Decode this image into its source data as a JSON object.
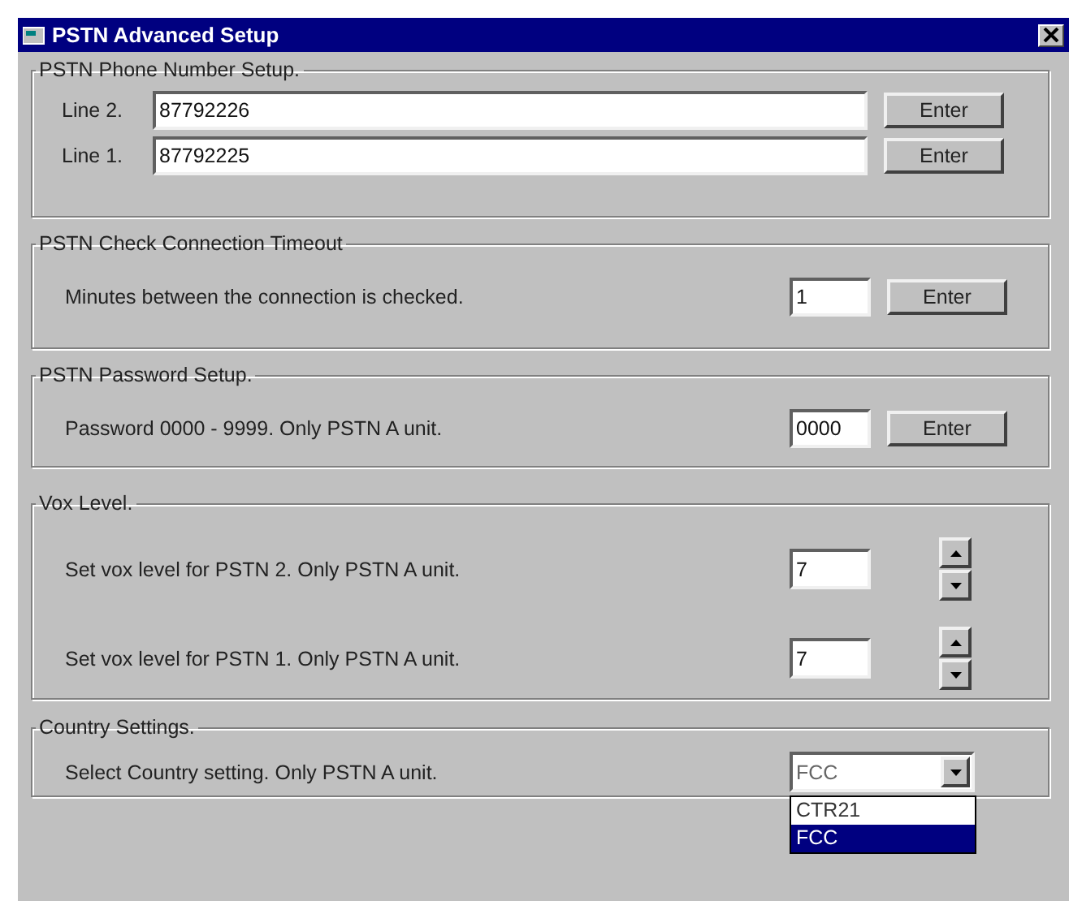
{
  "window": {
    "title": "PSTN Advanced Setup"
  },
  "groups": [
    {
      "title": "PSTN Phone Number Setup.",
      "rows": [
        {
          "kind": "line",
          "label": "Line 2.",
          "value": "87792226",
          "button": "Enter"
        },
        {
          "kind": "line",
          "label": "Line 1.",
          "value": "87792225",
          "button": "Enter"
        }
      ]
    },
    {
      "title": "PSTN Check Connection Timeout",
      "rows": [
        {
          "kind": "entry",
          "label": "Minutes between the connection is checked.",
          "value": "1",
          "button": "Enter"
        }
      ]
    },
    {
      "title": "PSTN Password Setup.",
      "rows": [
        {
          "kind": "entry",
          "label": "Password 0000 - 9999. Only PSTN A unit.",
          "value": "0000",
          "button": "Enter"
        }
      ]
    },
    {
      "title": "Vox Level.",
      "rows": [
        {
          "kind": "spin",
          "label": "Set vox level for PSTN 2. Only PSTN A unit.",
          "value": "7"
        },
        {
          "kind": "spin",
          "label": "Set vox level for PSTN 1. Only PSTN A unit.",
          "value": "7"
        }
      ]
    },
    {
      "title": "Country Settings.",
      "rows": [
        {
          "kind": "select",
          "label": "Select Country setting. Only PSTN A unit.",
          "value": "FCC",
          "expanded": true,
          "options": [
            {
              "label": "CTR21",
              "selected": false
            },
            {
              "label": "FCC",
              "selected": true
            }
          ]
        }
      ]
    }
  ]
}
